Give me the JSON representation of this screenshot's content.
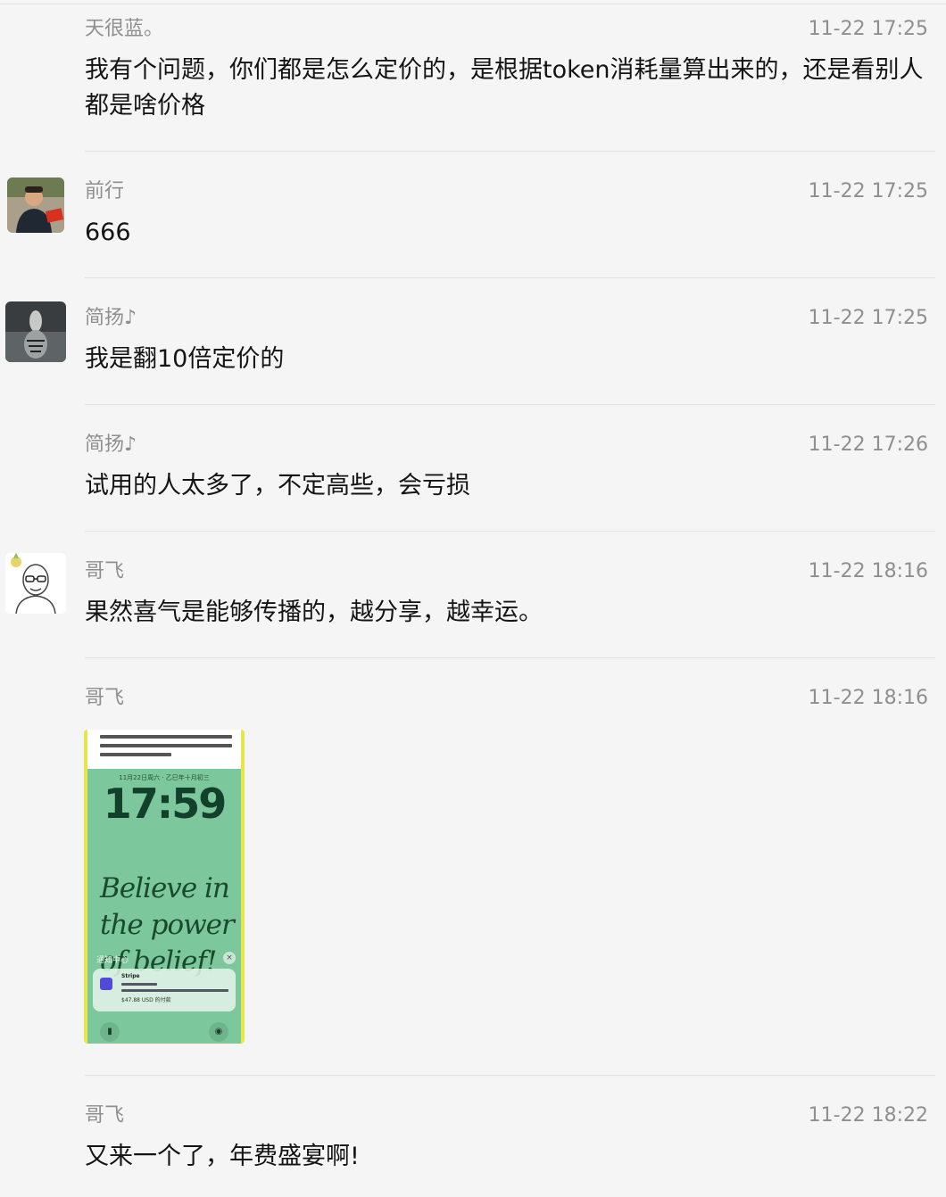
{
  "messages": [
    {
      "name": "天很蓝。",
      "time": "11-22 17:25",
      "text": "我有个问题，你们都是怎么定价的，是根据token消耗量算出来的，还是看别人都是啥价格"
    },
    {
      "name": "前行",
      "time": "11-22 17:25",
      "text": "666"
    },
    {
      "name": "简扬♪",
      "time": "11-22 17:25",
      "text": "我是翻10倍定价的"
    },
    {
      "name": "简扬♪",
      "time": "11-22 17:26",
      "text": "试用的人太多了，不定高些，会亏损"
    },
    {
      "name": "哥飞",
      "time": "11-22 18:16",
      "text": "果然喜气是能够传播的，越分享，越幸运。"
    },
    {
      "name": "哥飞",
      "time": "11-22 18:16"
    },
    {
      "name": "哥飞",
      "time": "11-22 18:22",
      "text": "又来一个了，年费盛宴啊!"
    }
  ],
  "shared_image": {
    "date_line": "11月22日周六 · 乙巳年十月初三",
    "clock": "17:59",
    "quote": "Believe in the power of belief!",
    "notification_label": "通知中心",
    "app_name": "Stripe",
    "amount": "$47.88 USD 的付款"
  },
  "colors": {
    "background": "#f5f5f5",
    "meta_text": "#8f8f8f",
    "divider": "#e2e2e2"
  }
}
